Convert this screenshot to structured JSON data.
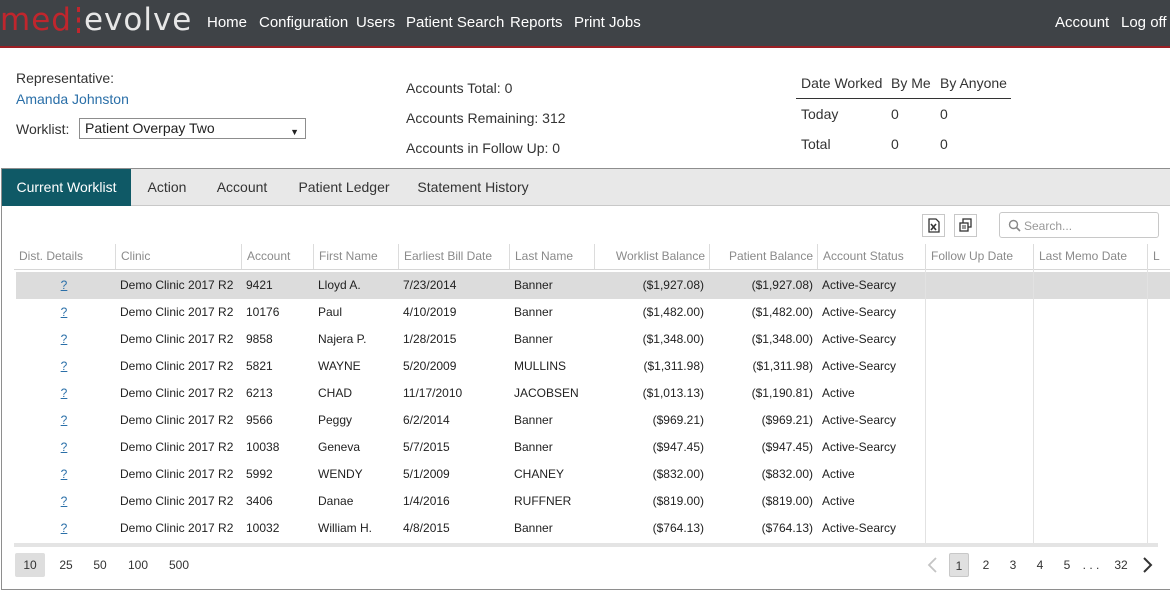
{
  "brand": {
    "part1": "med",
    "part2": "evolve",
    "color": "#c0262d"
  },
  "nav": {
    "items": [
      "Home",
      "Configuration",
      "Users",
      "Patient Search",
      "Reports",
      "Print Jobs"
    ],
    "account": "Account",
    "logoff": "Log off"
  },
  "header": {
    "representative_label": "Representative:",
    "representative_name": "Amanda Johnston",
    "worklist_label": "Worklist:",
    "worklist_value": "Patient Overpay Two",
    "accounts_total": "Accounts Total: 0",
    "accounts_remaining": "Accounts Remaining: 312",
    "accounts_followup": "Accounts in Follow Up: 0"
  },
  "date_worked": {
    "headers": [
      "Date Worked",
      "By Me",
      "By Anyone"
    ],
    "rows": [
      [
        "Today",
        "0",
        "0"
      ],
      [
        "Total",
        "0",
        "0"
      ]
    ]
  },
  "tabs": [
    "Current Worklist",
    "Action",
    "Account",
    "Patient Ledger",
    "Statement History"
  ],
  "toolbar": {
    "excel_icon": "excel-export-icon",
    "columns_icon": "column-chooser-icon",
    "search_placeholder": "Search..."
  },
  "grid": {
    "columns": [
      "Dist. Details",
      "Clinic",
      "Account",
      "First Name",
      "Earliest Bill Date",
      "Last Name",
      "Worklist Balance",
      "Patient Balance",
      "Account Status",
      "Follow Up Date",
      "Last Memo Date",
      "L"
    ],
    "rows": [
      [
        "?",
        "Demo Clinic 2017 R2",
        "9421",
        "Lloyd A.",
        "7/23/2014",
        "Banner",
        "($1,927.08)",
        "($1,927.08)",
        "Active-Searcy"
      ],
      [
        "?",
        "Demo Clinic 2017 R2",
        "10176",
        "Paul",
        "4/10/2019",
        "Banner",
        "($1,482.00)",
        "($1,482.00)",
        "Active-Searcy"
      ],
      [
        "?",
        "Demo Clinic 2017 R2",
        "9858",
        "Najera P.",
        "1/28/2015",
        "Banner",
        "($1,348.00)",
        "($1,348.00)",
        "Active-Searcy"
      ],
      [
        "?",
        "Demo Clinic 2017 R2",
        "5821",
        "WAYNE",
        "5/20/2009",
        "MULLINS",
        "($1,311.98)",
        "($1,311.98)",
        "Active-Searcy"
      ],
      [
        "?",
        "Demo Clinic 2017 R2",
        "6213",
        "CHAD",
        "11/17/2010",
        "JACOBSEN",
        "($1,013.13)",
        "($1,190.81)",
        "Active"
      ],
      [
        "?",
        "Demo Clinic 2017 R2",
        "9566",
        "Peggy",
        "6/2/2014",
        "Banner",
        "($969.21)",
        "($969.21)",
        "Active-Searcy"
      ],
      [
        "?",
        "Demo Clinic 2017 R2",
        "10038",
        "Geneva",
        "5/7/2015",
        "Banner",
        "($947.45)",
        "($947.45)",
        "Active-Searcy"
      ],
      [
        "?",
        "Demo Clinic 2017 R2",
        "5992",
        "WENDY",
        "5/1/2009",
        "CHANEY",
        "($832.00)",
        "($832.00)",
        "Active"
      ],
      [
        "?",
        "Demo Clinic 2017 R2",
        "3406",
        "Danae",
        "1/4/2016",
        "RUFFNER",
        "($819.00)",
        "($819.00)",
        "Active"
      ],
      [
        "?",
        "Demo Clinic 2017 R2",
        "10032",
        "William H.",
        "4/8/2015",
        "Banner",
        "($764.13)",
        "($764.13)",
        "Active-Searcy"
      ]
    ]
  },
  "pagination": {
    "page_sizes": [
      "10",
      "25",
      "50",
      "100",
      "500"
    ],
    "pages": [
      "1",
      "2",
      "3",
      "4",
      "5"
    ],
    "ellipsis": ". . .",
    "last_page": "32"
  },
  "colors": {
    "nav_bg": "#3f4347",
    "accent": "#0f5966",
    "link": "#2a6fa8",
    "selected_row": "#dcdcdc"
  }
}
